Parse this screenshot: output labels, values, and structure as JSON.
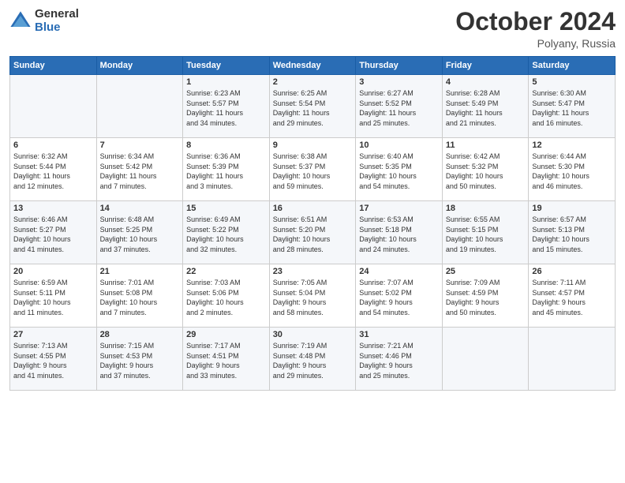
{
  "logo": {
    "general": "General",
    "blue": "Blue"
  },
  "title": "October 2024",
  "location": "Polyany, Russia",
  "weekdays": [
    "Sunday",
    "Monday",
    "Tuesday",
    "Wednesday",
    "Thursday",
    "Friday",
    "Saturday"
  ],
  "weeks": [
    [
      {
        "day": "",
        "detail": ""
      },
      {
        "day": "",
        "detail": ""
      },
      {
        "day": "1",
        "detail": "Sunrise: 6:23 AM\nSunset: 5:57 PM\nDaylight: 11 hours\nand 34 minutes."
      },
      {
        "day": "2",
        "detail": "Sunrise: 6:25 AM\nSunset: 5:54 PM\nDaylight: 11 hours\nand 29 minutes."
      },
      {
        "day": "3",
        "detail": "Sunrise: 6:27 AM\nSunset: 5:52 PM\nDaylight: 11 hours\nand 25 minutes."
      },
      {
        "day": "4",
        "detail": "Sunrise: 6:28 AM\nSunset: 5:49 PM\nDaylight: 11 hours\nand 21 minutes."
      },
      {
        "day": "5",
        "detail": "Sunrise: 6:30 AM\nSunset: 5:47 PM\nDaylight: 11 hours\nand 16 minutes."
      }
    ],
    [
      {
        "day": "6",
        "detail": "Sunrise: 6:32 AM\nSunset: 5:44 PM\nDaylight: 11 hours\nand 12 minutes."
      },
      {
        "day": "7",
        "detail": "Sunrise: 6:34 AM\nSunset: 5:42 PM\nDaylight: 11 hours\nand 7 minutes."
      },
      {
        "day": "8",
        "detail": "Sunrise: 6:36 AM\nSunset: 5:39 PM\nDaylight: 11 hours\nand 3 minutes."
      },
      {
        "day": "9",
        "detail": "Sunrise: 6:38 AM\nSunset: 5:37 PM\nDaylight: 10 hours\nand 59 minutes."
      },
      {
        "day": "10",
        "detail": "Sunrise: 6:40 AM\nSunset: 5:35 PM\nDaylight: 10 hours\nand 54 minutes."
      },
      {
        "day": "11",
        "detail": "Sunrise: 6:42 AM\nSunset: 5:32 PM\nDaylight: 10 hours\nand 50 minutes."
      },
      {
        "day": "12",
        "detail": "Sunrise: 6:44 AM\nSunset: 5:30 PM\nDaylight: 10 hours\nand 46 minutes."
      }
    ],
    [
      {
        "day": "13",
        "detail": "Sunrise: 6:46 AM\nSunset: 5:27 PM\nDaylight: 10 hours\nand 41 minutes."
      },
      {
        "day": "14",
        "detail": "Sunrise: 6:48 AM\nSunset: 5:25 PM\nDaylight: 10 hours\nand 37 minutes."
      },
      {
        "day": "15",
        "detail": "Sunrise: 6:49 AM\nSunset: 5:22 PM\nDaylight: 10 hours\nand 32 minutes."
      },
      {
        "day": "16",
        "detail": "Sunrise: 6:51 AM\nSunset: 5:20 PM\nDaylight: 10 hours\nand 28 minutes."
      },
      {
        "day": "17",
        "detail": "Sunrise: 6:53 AM\nSunset: 5:18 PM\nDaylight: 10 hours\nand 24 minutes."
      },
      {
        "day": "18",
        "detail": "Sunrise: 6:55 AM\nSunset: 5:15 PM\nDaylight: 10 hours\nand 19 minutes."
      },
      {
        "day": "19",
        "detail": "Sunrise: 6:57 AM\nSunset: 5:13 PM\nDaylight: 10 hours\nand 15 minutes."
      }
    ],
    [
      {
        "day": "20",
        "detail": "Sunrise: 6:59 AM\nSunset: 5:11 PM\nDaylight: 10 hours\nand 11 minutes."
      },
      {
        "day": "21",
        "detail": "Sunrise: 7:01 AM\nSunset: 5:08 PM\nDaylight: 10 hours\nand 7 minutes."
      },
      {
        "day": "22",
        "detail": "Sunrise: 7:03 AM\nSunset: 5:06 PM\nDaylight: 10 hours\nand 2 minutes."
      },
      {
        "day": "23",
        "detail": "Sunrise: 7:05 AM\nSunset: 5:04 PM\nDaylight: 9 hours\nand 58 minutes."
      },
      {
        "day": "24",
        "detail": "Sunrise: 7:07 AM\nSunset: 5:02 PM\nDaylight: 9 hours\nand 54 minutes."
      },
      {
        "day": "25",
        "detail": "Sunrise: 7:09 AM\nSunset: 4:59 PM\nDaylight: 9 hours\nand 50 minutes."
      },
      {
        "day": "26",
        "detail": "Sunrise: 7:11 AM\nSunset: 4:57 PM\nDaylight: 9 hours\nand 45 minutes."
      }
    ],
    [
      {
        "day": "27",
        "detail": "Sunrise: 7:13 AM\nSunset: 4:55 PM\nDaylight: 9 hours\nand 41 minutes."
      },
      {
        "day": "28",
        "detail": "Sunrise: 7:15 AM\nSunset: 4:53 PM\nDaylight: 9 hours\nand 37 minutes."
      },
      {
        "day": "29",
        "detail": "Sunrise: 7:17 AM\nSunset: 4:51 PM\nDaylight: 9 hours\nand 33 minutes."
      },
      {
        "day": "30",
        "detail": "Sunrise: 7:19 AM\nSunset: 4:48 PM\nDaylight: 9 hours\nand 29 minutes."
      },
      {
        "day": "31",
        "detail": "Sunrise: 7:21 AM\nSunset: 4:46 PM\nDaylight: 9 hours\nand 25 minutes."
      },
      {
        "day": "",
        "detail": ""
      },
      {
        "day": "",
        "detail": ""
      }
    ]
  ]
}
